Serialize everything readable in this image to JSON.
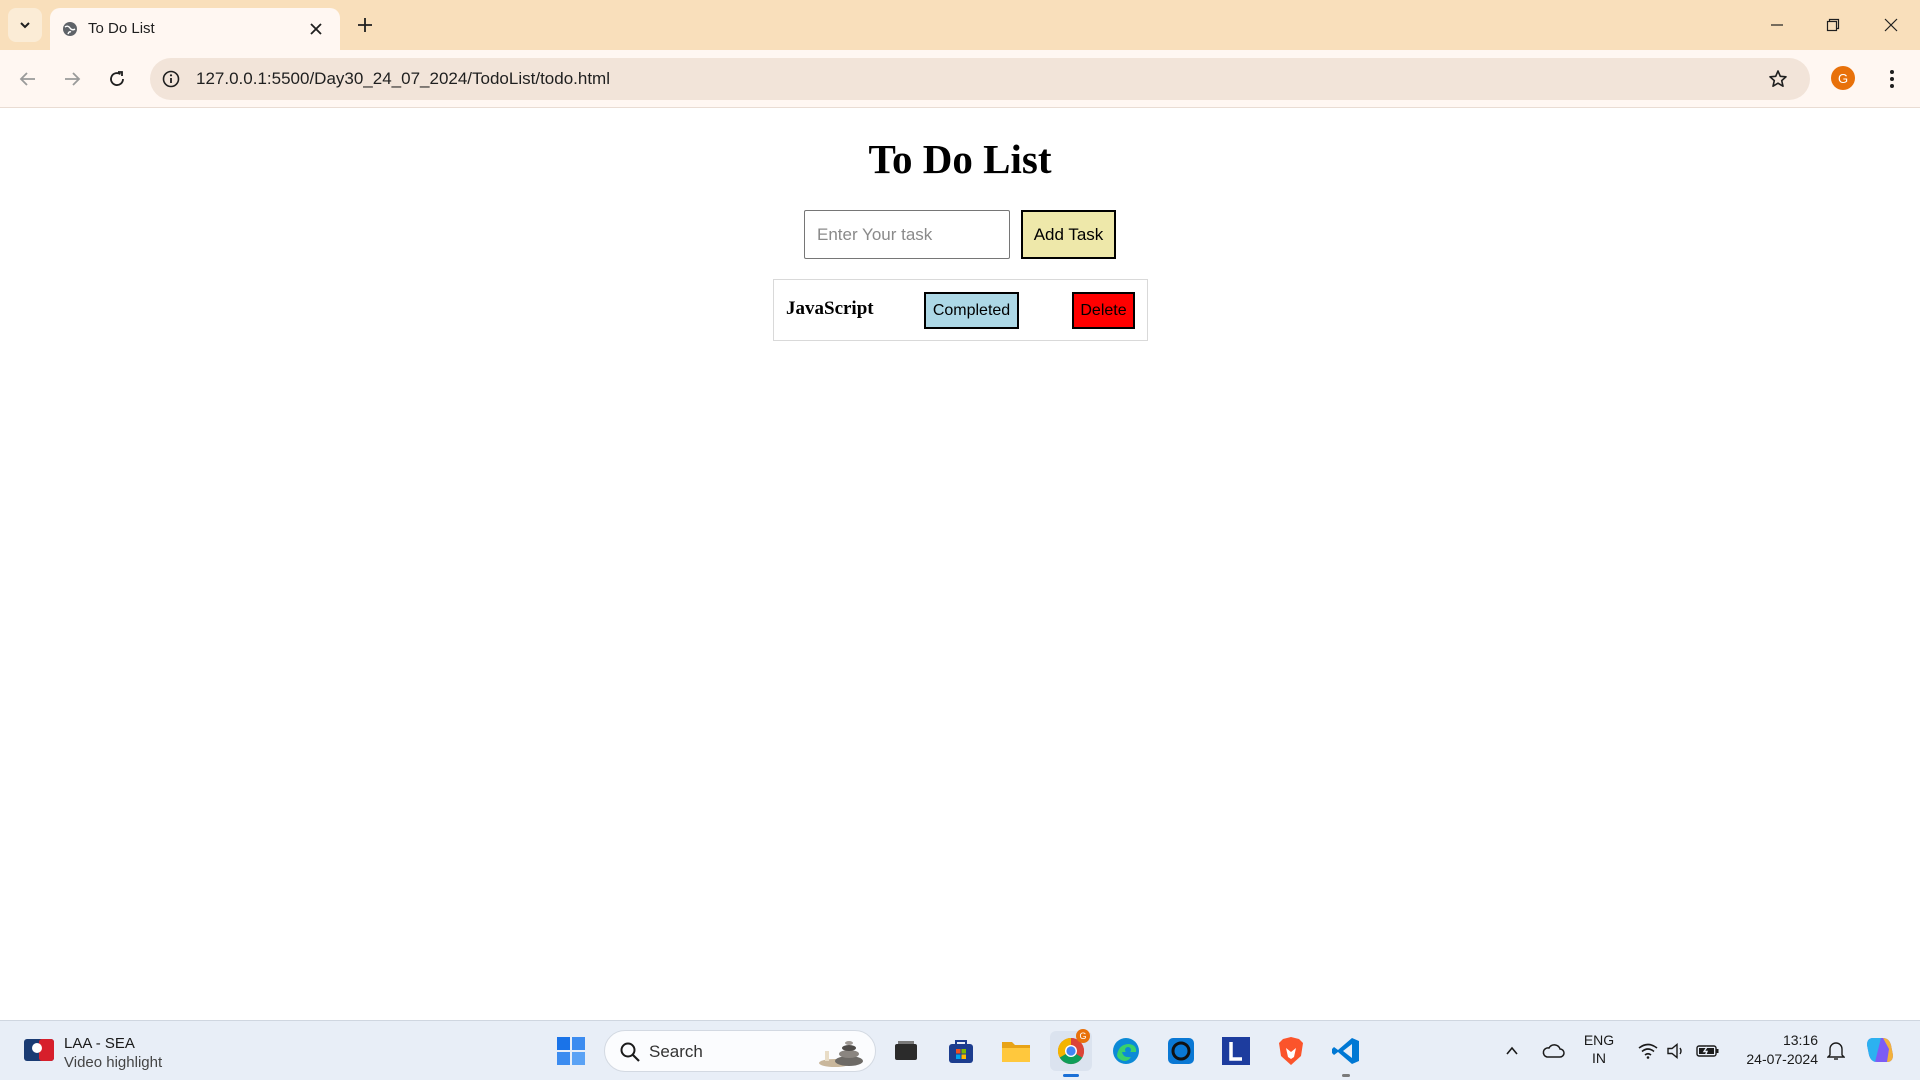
{
  "browser": {
    "tab": {
      "title": "To Do List"
    },
    "url": "127.0.0.1:5500/Day30_24_07_2024/TodoList/todo.html",
    "profile_initial": "G"
  },
  "page": {
    "title": "To Do List",
    "input": {
      "value": "",
      "placeholder": "Enter Your task"
    },
    "add_button_label": "Add Task",
    "tasks": [
      {
        "text": "JavaScript",
        "complete_label": "Completed",
        "delete_label": "Delete"
      }
    ],
    "colors": {
      "add_button": "#eee8aa",
      "complete_button": "#add8e6",
      "delete_button": "#ff0000"
    }
  },
  "taskbar": {
    "weather": {
      "title": "LAA - SEA",
      "subtitle": "Video highlight"
    },
    "search_label": "Search",
    "apps": [
      "windows-start",
      "task-view",
      "microsoft-store",
      "file-explorer",
      "chrome",
      "edge",
      "cortana",
      "l-app",
      "brave",
      "vscode"
    ],
    "chrome_badge": "G",
    "language": {
      "line1": "ENG",
      "line2": "IN"
    },
    "clock": {
      "time": "13:16",
      "date": "24-07-2024"
    }
  }
}
